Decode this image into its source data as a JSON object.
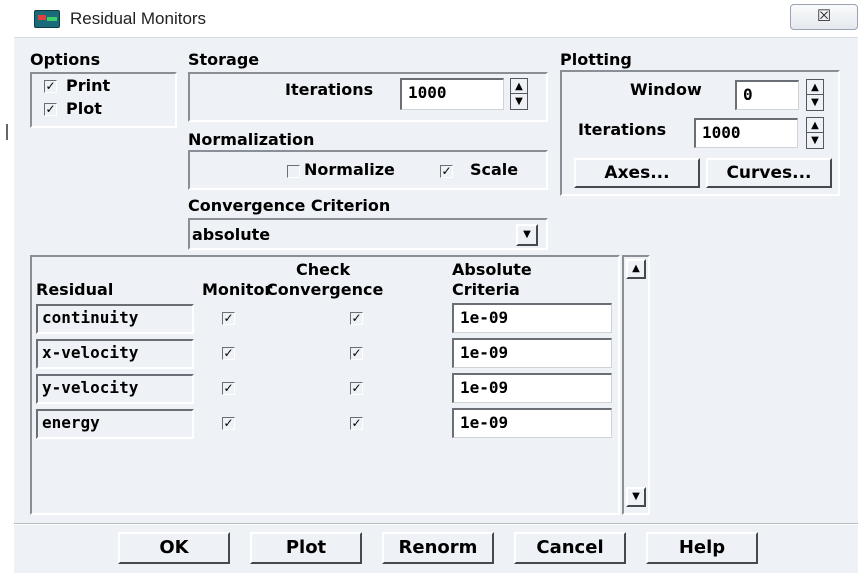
{
  "window": {
    "title": "Residual Monitors",
    "close_glyph": "☒"
  },
  "options": {
    "heading": "Options",
    "print": {
      "label": "Print",
      "checked": true
    },
    "plot": {
      "label": "Plot",
      "checked": true
    }
  },
  "storage": {
    "heading": "Storage",
    "iterations_label": "Iterations",
    "iterations_value": "1000"
  },
  "normalization": {
    "heading": "Normalization",
    "normalize": {
      "label": "Normalize",
      "checked": false
    },
    "scale": {
      "label": "Scale",
      "checked": true
    }
  },
  "convergence": {
    "heading": "Convergence Criterion",
    "selected": "absolute"
  },
  "plotting": {
    "heading": "Plotting",
    "window_label": "Window",
    "window_value": "0",
    "iterations_label": "Iterations",
    "iterations_value": "1000",
    "axes_button": "Axes...",
    "curves_button": "Curves..."
  },
  "table": {
    "headers": {
      "residual": "Residual",
      "monitor": "Monitor",
      "check_1": "Check",
      "check_2": "Convergence",
      "abs_1": "Absolute",
      "abs_2": "Criteria"
    },
    "rows": [
      {
        "name": "continuity",
        "monitor": true,
        "check": true,
        "criteria": "1e-09"
      },
      {
        "name": "x-velocity",
        "monitor": true,
        "check": true,
        "criteria": "1e-09"
      },
      {
        "name": "y-velocity",
        "monitor": true,
        "check": true,
        "criteria": "1e-09"
      },
      {
        "name": "energy",
        "monitor": true,
        "check": true,
        "criteria": "1e-09"
      }
    ]
  },
  "buttons": {
    "ok": "OK",
    "plot": "Plot",
    "renorm": "Renorm",
    "cancel": "Cancel",
    "help": "Help"
  },
  "glyphs": {
    "check": "✓",
    "arrow_up": "▲",
    "arrow_down": "▼"
  },
  "colors": {
    "window_bg": "#eef1f5",
    "title_icon": "#1b6a7a"
  }
}
